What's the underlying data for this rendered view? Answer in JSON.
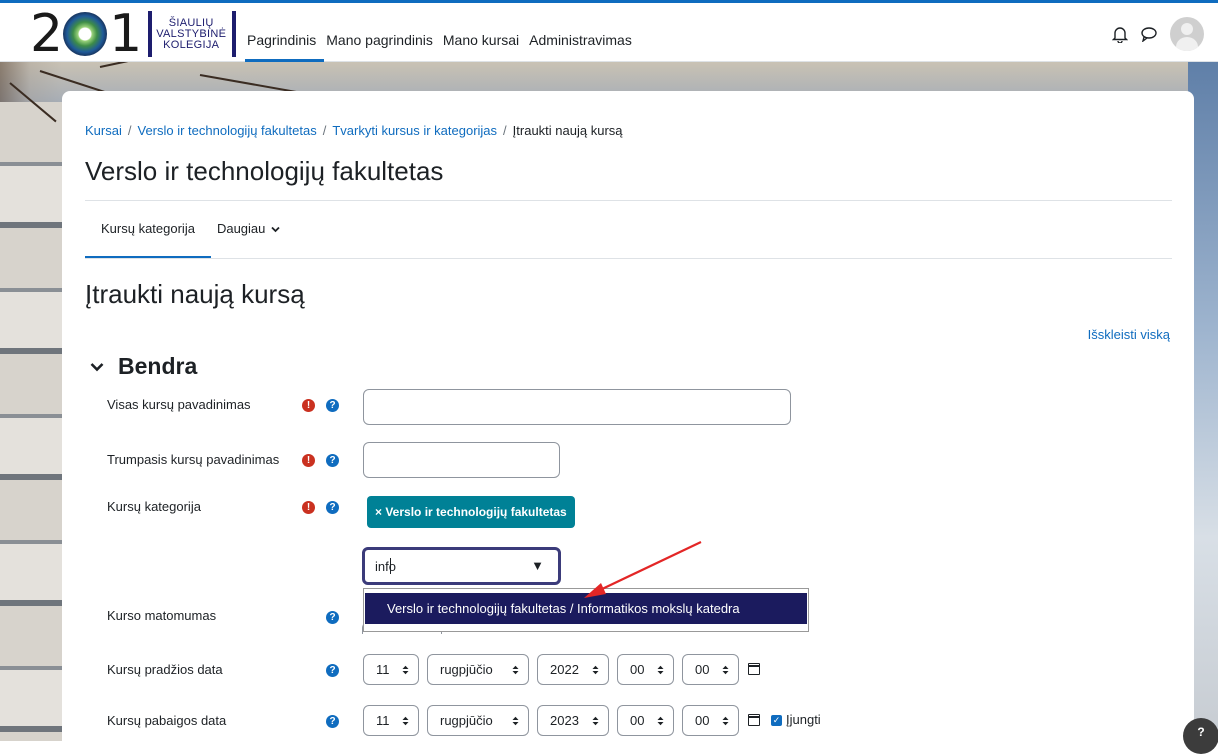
{
  "logo": {
    "digits_left": "2",
    "digits_right": "1",
    "line1": "ŠIAULIŲ",
    "line2": "VALSTYBINĖ",
    "line3": "KOLEGIJA"
  },
  "nav": {
    "items": [
      {
        "label": "Pagrindinis"
      },
      {
        "label": "Mano pagrindinis"
      },
      {
        "label": "Mano kursai"
      },
      {
        "label": "Administravimas"
      }
    ]
  },
  "breadcrumb": {
    "items": [
      "Kursai",
      "Verslo ir technologijų fakultetas",
      "Tvarkyti kursus ir kategorijas",
      "Įtraukti naują kursą"
    ],
    "separator": "/"
  },
  "page": {
    "title": "Verslo ir technologijų fakultetas",
    "tabs": [
      {
        "label": "Kursų kategorija"
      },
      {
        "label": "Daugiau"
      }
    ],
    "heading": "Įtraukti naują kursą",
    "expand_all": "Išskleisti viską"
  },
  "form": {
    "section_title": "Bendra",
    "fields": {
      "fullname": {
        "label": "Visas kursų pavadinimas",
        "value": ""
      },
      "shortname": {
        "label": "Trumpasis kursų pavadinimas",
        "value": ""
      },
      "category": {
        "label": "Kursų kategorija",
        "selected": "× Verslo ir technologijų fakultetas",
        "search_value": "info",
        "dropdown_option": "Verslo ir technologijų fakultetas / Informatikos mokslų katedra"
      },
      "visibility": {
        "label": "Kurso matomumas"
      },
      "startdate": {
        "label": "Kursų pradžios data",
        "day": "11",
        "month": "rugpjūčio",
        "year": "2022",
        "hour": "00",
        "minute": "00"
      },
      "enddate": {
        "label": "Kursų pabaigos data",
        "day": "11",
        "month": "rugpjūčio",
        "year": "2023",
        "hour": "00",
        "minute": "00",
        "enable_label": "Įjungti"
      }
    },
    "icons": {
      "required": "!",
      "help": "?"
    }
  },
  "help_button": "?",
  "colors": {
    "accent": "#0f6cbf",
    "chip": "#008196",
    "dropdown_highlight": "#1b1b5e",
    "required": "#ca3120",
    "annotation_arrow": "#e32626"
  }
}
